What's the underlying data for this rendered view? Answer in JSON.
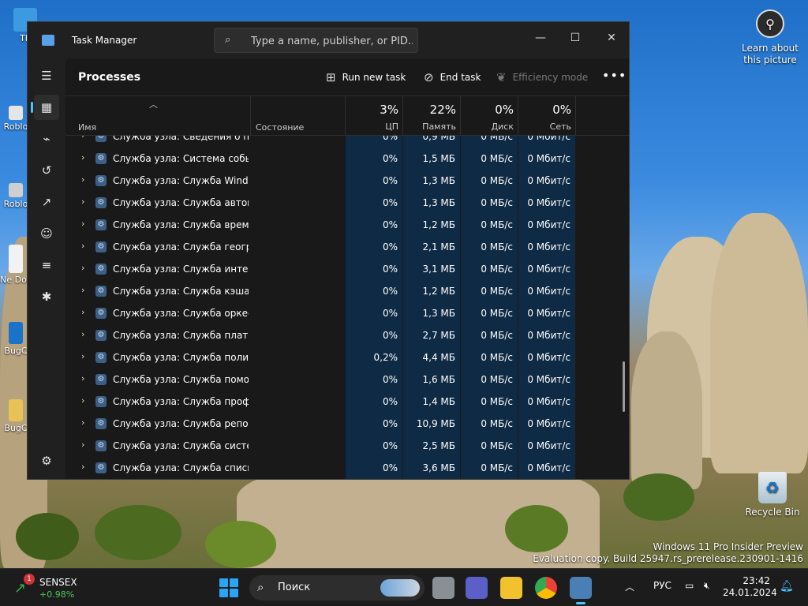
{
  "desktop": {
    "icons": [
      {
        "label": "Th"
      },
      {
        "label": "Roblo"
      },
      {
        "label": "Roblo"
      },
      {
        "label": "Ne\nDoc"
      },
      {
        "label": "BugC"
      },
      {
        "label": "BugC"
      }
    ],
    "learn_label": "Learn about this picture",
    "recycle_label": "Recycle Bin",
    "watermark_line1": "Windows 11 Pro Insider Preview",
    "watermark_line2": "Evaluation copy. Build 25947.rs_prerelease.230901-1416"
  },
  "window": {
    "title": "Task Manager",
    "search_placeholder": "Type a name, publisher, or PID..."
  },
  "toolbar": {
    "page_title": "Processes",
    "run_new_task": "Run new task",
    "end_task": "End task",
    "efficiency_mode": "Efficiency mode"
  },
  "columns": {
    "name": "Имя",
    "status": "Состояние",
    "cpu": {
      "pct": "3%",
      "label": "ЦП"
    },
    "memory": {
      "pct": "22%",
      "label": "Память"
    },
    "disk": {
      "pct": "0%",
      "label": "Диск"
    },
    "network": {
      "pct": "0%",
      "label": "Сеть"
    }
  },
  "rows": [
    {
      "name": "Служба узла: Сведения о пр...",
      "cpu": "0%",
      "mem": "0,9 МБ",
      "disk": "0 МБ/с",
      "net": "0 Мбит/с"
    },
    {
      "name": "Служба узла: Система событ...",
      "cpu": "0%",
      "mem": "1,5 МБ",
      "disk": "0 МБ/с",
      "net": "0 Мбит/с"
    },
    {
      "name": "Служба узла: Служба Windo...",
      "cpu": "0%",
      "mem": "1,3 МБ",
      "disk": "0 МБ/с",
      "net": "0 Мбит/с"
    },
    {
      "name": "Служба узла: Служба автом...",
      "cpu": "0%",
      "mem": "1,3 МБ",
      "disk": "0 МБ/с",
      "net": "0 Мбит/с"
    },
    {
      "name": "Служба узла: Служба време...",
      "cpu": "0%",
      "mem": "1,2 МБ",
      "disk": "0 МБ/с",
      "net": "0 Мбит/с"
    },
    {
      "name": "Служба узла: Служба геогра...",
      "cpu": "0%",
      "mem": "2,1 МБ",
      "disk": "0 МБ/с",
      "net": "0 Мбит/с"
    },
    {
      "name": "Служба узла: Служба интер...",
      "cpu": "0%",
      "mem": "3,1 МБ",
      "disk": "0 МБ/с",
      "net": "0 Мбит/с"
    },
    {
      "name": "Служба узла: Служба кэша ...",
      "cpu": "0%",
      "mem": "1,2 МБ",
      "disk": "0 МБ/с",
      "net": "0 Мбит/с"
    },
    {
      "name": "Служба узла: Служба оркест...",
      "cpu": "0%",
      "mem": "1,3 МБ",
      "disk": "0 МБ/с",
      "net": "0 Мбит/с"
    },
    {
      "name": "Служба узла: Служба платф...",
      "cpu": "0%",
      "mem": "2,7 МБ",
      "disk": "0 МБ/с",
      "net": "0 Мбит/с"
    },
    {
      "name": "Служба узла: Служба полит...",
      "cpu": "0,2%",
      "mem": "4,4 МБ",
      "disk": "0 МБ/с",
      "net": "0 Мбит/с"
    },
    {
      "name": "Служба узла: Служба помо...",
      "cpu": "0%",
      "mem": "1,6 МБ",
      "disk": "0 МБ/с",
      "net": "0 Мбит/с"
    },
    {
      "name": "Служба узла: Служба профи...",
      "cpu": "0%",
      "mem": "1,4 МБ",
      "disk": "0 МБ/с",
      "net": "0 Мбит/с"
    },
    {
      "name": "Служба узла: Служба репоз...",
      "cpu": "0%",
      "mem": "10,9 МБ",
      "disk": "0 МБ/с",
      "net": "0 Мбит/с"
    },
    {
      "name": "Служба узла: Служба систе...",
      "cpu": "0%",
      "mem": "2,5 МБ",
      "disk": "0 МБ/с",
      "net": "0 Мбит/с"
    },
    {
      "name": "Служба узла: Служба списка...",
      "cpu": "0%",
      "mem": "3,6 МБ",
      "disk": "0 МБ/с",
      "net": "0 Мбит/с"
    }
  ],
  "taskbar": {
    "widget_name": "SENSEX",
    "widget_change": "+0.98%",
    "widget_badge": "1",
    "search_label": "Поиск",
    "lang": "РУС",
    "time": "23:42",
    "date": "24.01.2024"
  },
  "colors": {
    "accent": "#4cc2ff",
    "highlight_column": "#0f2a44"
  }
}
